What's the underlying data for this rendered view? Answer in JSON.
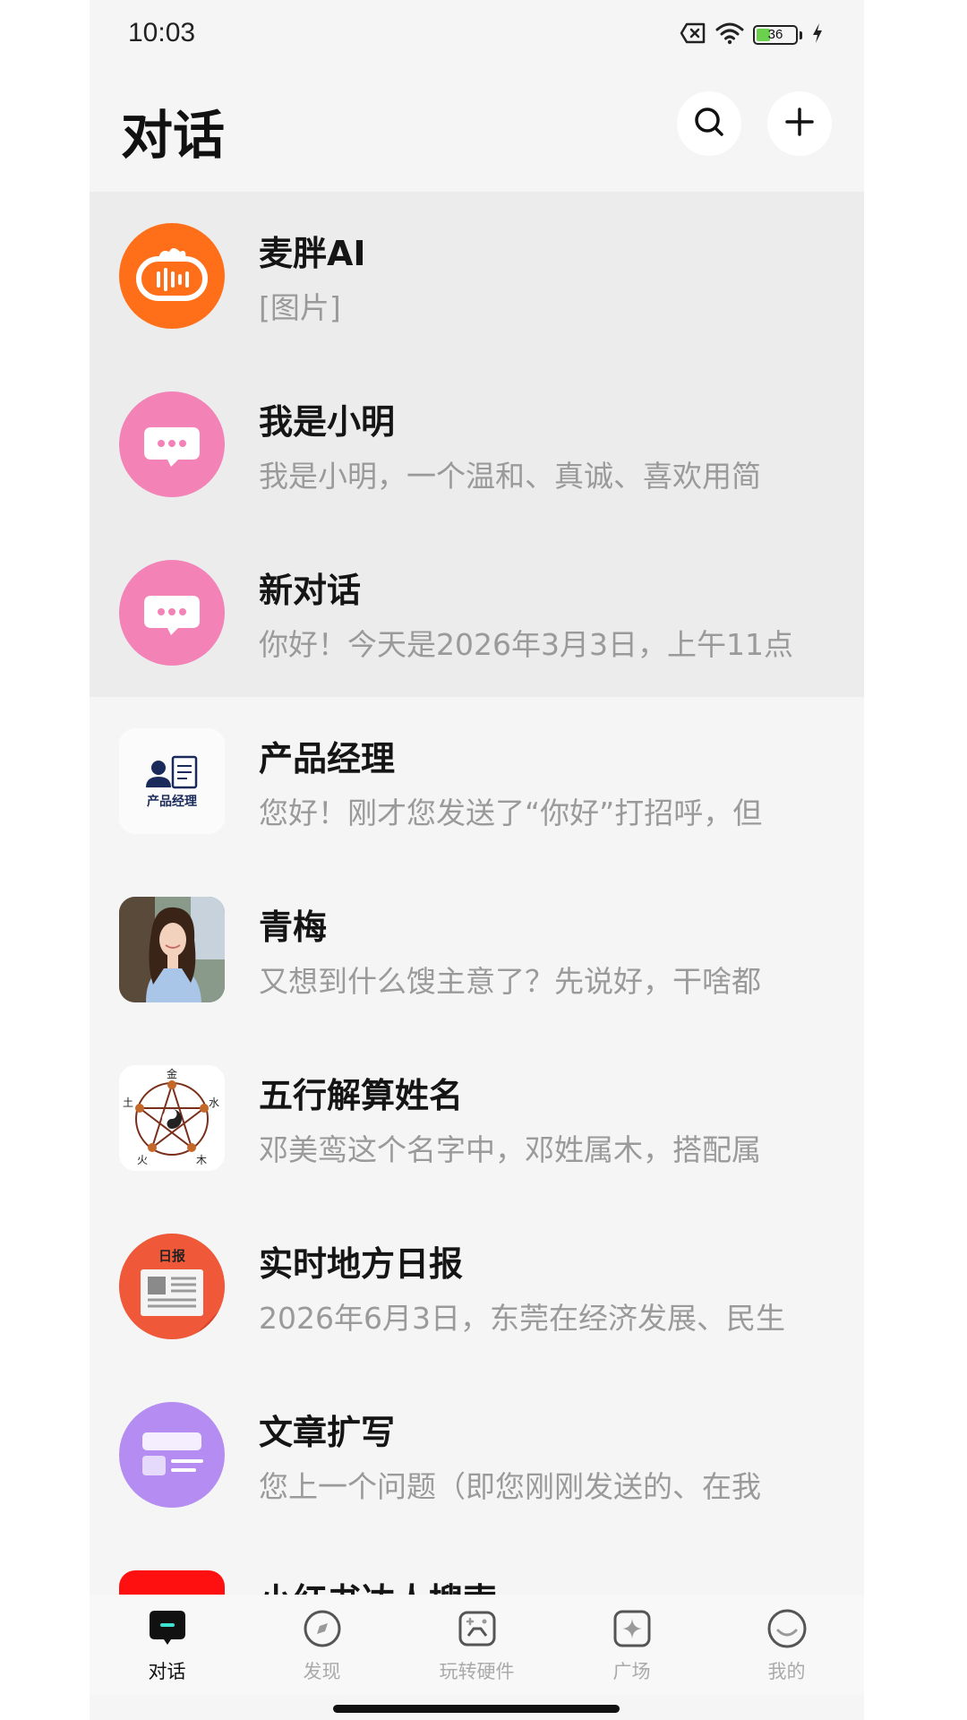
{
  "status_bar": {
    "time": "10:03",
    "battery_level": 36,
    "battery_text": "36",
    "icons": [
      "sim-off-icon",
      "wifi-icon",
      "battery-icon",
      "charging-icon"
    ]
  },
  "header": {
    "title": "对话",
    "search_icon": "search-icon",
    "add_icon": "plus-icon"
  },
  "chats": [
    {
      "name": "麦胖AI",
      "preview": "[图片]",
      "pinned": true,
      "avatar": "robot-icon",
      "color": "#ff6f1a"
    },
    {
      "name": "我是小明",
      "preview": "我是小明，一个温和、真诚、喜欢用简",
      "pinned": true,
      "avatar": "chat-bubble-icon",
      "color": "#f383b7"
    },
    {
      "name": "新对话",
      "preview": "你好！今天是2026年3月3日，上午11点",
      "pinned": true,
      "avatar": "chat-bubble-icon",
      "color": "#f383b7"
    },
    {
      "name": "产品经理",
      "preview": "您好！刚才您发送了“你好”打招呼，但",
      "pinned": false,
      "avatar": "product-manager-icon",
      "avatar_text": "产品经理"
    },
    {
      "name": "青梅",
      "preview": "又想到什么馊主意了？先说好，干啥都",
      "pinned": false,
      "avatar": "portrait-photo"
    },
    {
      "name": "五行解算姓名",
      "preview": "邓美鸾这个名字中，邓姓属木，搭配属",
      "pinned": false,
      "avatar": "five-elements-icon",
      "avatar_labels": [
        "金",
        "水",
        "木",
        "火",
        "土"
      ]
    },
    {
      "name": "实时地方日报",
      "preview": "2026年6月3日，东莞在经济发展、民生",
      "pinned": false,
      "avatar": "newspaper-icon",
      "avatar_text": "日报"
    },
    {
      "name": "文章扩写",
      "preview": "您上一个问题（即您刚刚发送的、在我",
      "pinned": false,
      "avatar": "article-icon",
      "color": "#b48cf2"
    },
    {
      "name": "小红书达人搜索",
      "preview": "",
      "pinned": false,
      "avatar": "red-square-icon",
      "color": "#ff1010"
    }
  ],
  "tabs": [
    {
      "label": "对话",
      "icon": "chat-tab-icon",
      "active": true
    },
    {
      "label": "发现",
      "icon": "compass-icon",
      "active": false
    },
    {
      "label": "玩转硬件",
      "icon": "gamepad-icon",
      "active": false
    },
    {
      "label": "广场",
      "icon": "sparkle-icon",
      "active": false
    },
    {
      "label": "我的",
      "icon": "profile-icon",
      "active": false
    }
  ]
}
